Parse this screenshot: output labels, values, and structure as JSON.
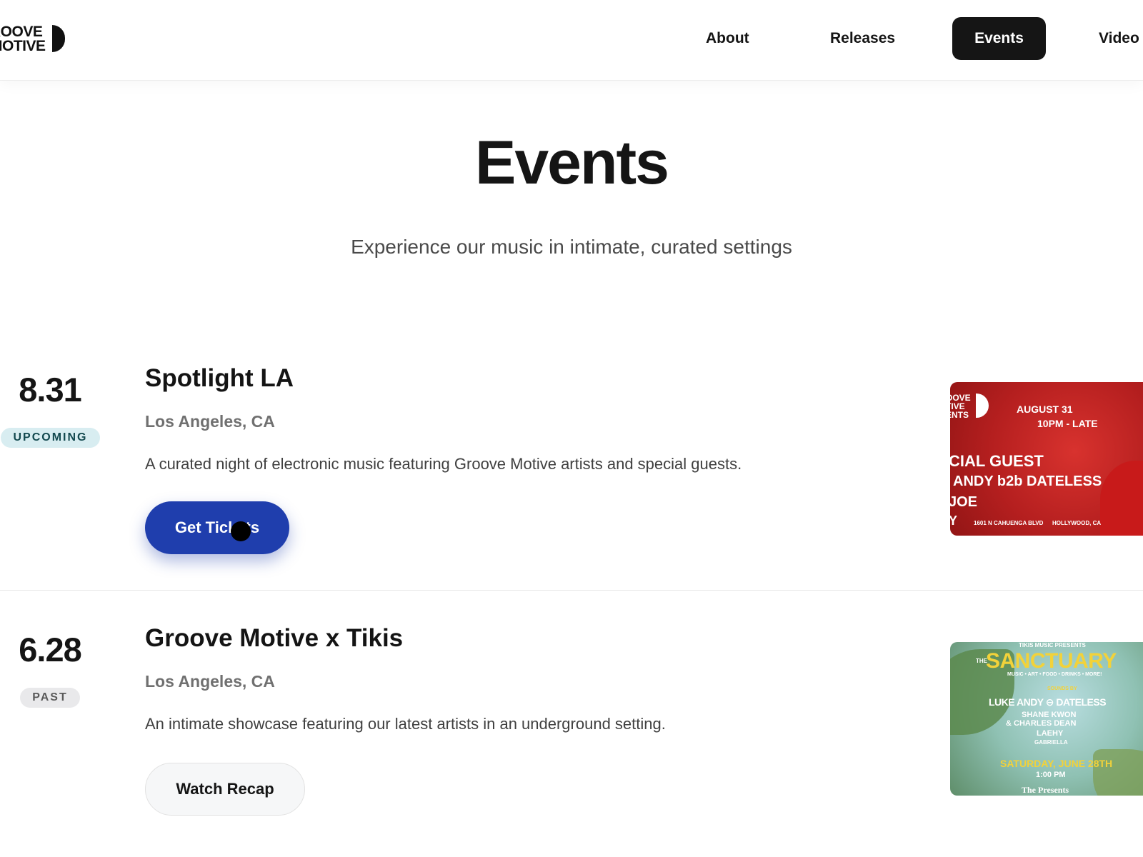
{
  "brand": {
    "logo_line1": "ROOVE",
    "logo_line2": "MOTIVE"
  },
  "nav": {
    "items": [
      {
        "label": "About"
      },
      {
        "label": "Releases"
      },
      {
        "label": "Events",
        "active": true
      },
      {
        "label": "Video"
      }
    ]
  },
  "page": {
    "title": "Events",
    "subtitle": "Experience our music in intimate, curated settings"
  },
  "events": [
    {
      "date": "8.31",
      "status": "UPCOMING",
      "title": "Spotlight LA",
      "location": "Los Angeles, CA",
      "description": "A curated night of electronic music featuring Groove Motive artists and special guests.",
      "button_label": "Get Tickets",
      "poster": {
        "logo_lines": [
          "OOVE",
          "TIVE",
          "ENTS"
        ],
        "date": "AUGUST 31",
        "time": "10PM - LATE",
        "headline": "CIAL GUEST",
        "lineup_1": "ANDY b2b DATELESS",
        "lineup_2": "JOE",
        "lineup_3": "Y",
        "address": "1601 N CAHUENGA BLVD",
        "city": "HOLLYWOOD, CA"
      }
    },
    {
      "date": "6.28",
      "status": "PAST",
      "title": "Groove Motive x Tikis",
      "location": "Los Angeles, CA",
      "description": "An intimate showcase featuring our latest artists in an underground setting.",
      "button_label": "Watch Recap",
      "poster": {
        "presents": "TIKIS MUSIC PRESENTS",
        "the": "THE",
        "title": "SANCTUARY",
        "tagline": "MUSIC • ART • FOOD • DRINKS • MORE!",
        "sounds_by": "SOUNDS BY",
        "artist_1": "LUKE ANDY ⊖ DATELESS",
        "artist_2": "SHANE KWON",
        "artist_3": "& CHARLES DEAN",
        "artist_4": "LAEHY",
        "artist_5": "GABRIELLA",
        "date": "SATURDAY, JUNE 28TH",
        "time": "1:00 PM",
        "presenter": "The Presents"
      }
    }
  ],
  "colors": {
    "primary_button": "#1f3ead",
    "nav_active_bg": "#151515",
    "badge_upcoming_bg": "#d8edf1",
    "badge_past_bg": "#e9e9eb"
  }
}
